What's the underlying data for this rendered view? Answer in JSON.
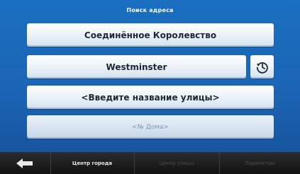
{
  "header": {
    "title": "Поиск адреса"
  },
  "fields": {
    "country": "Соединённое Королевство",
    "city": "Westminster",
    "street": "<Введите название улицы>",
    "house": "<№ Дома>"
  },
  "bottom_bar": {
    "city_center": "Центр города",
    "street_center": "Центр улицы",
    "options": "Параметры"
  },
  "icons": {
    "back": "back-arrow-icon",
    "recent": "history-clock-icon"
  }
}
